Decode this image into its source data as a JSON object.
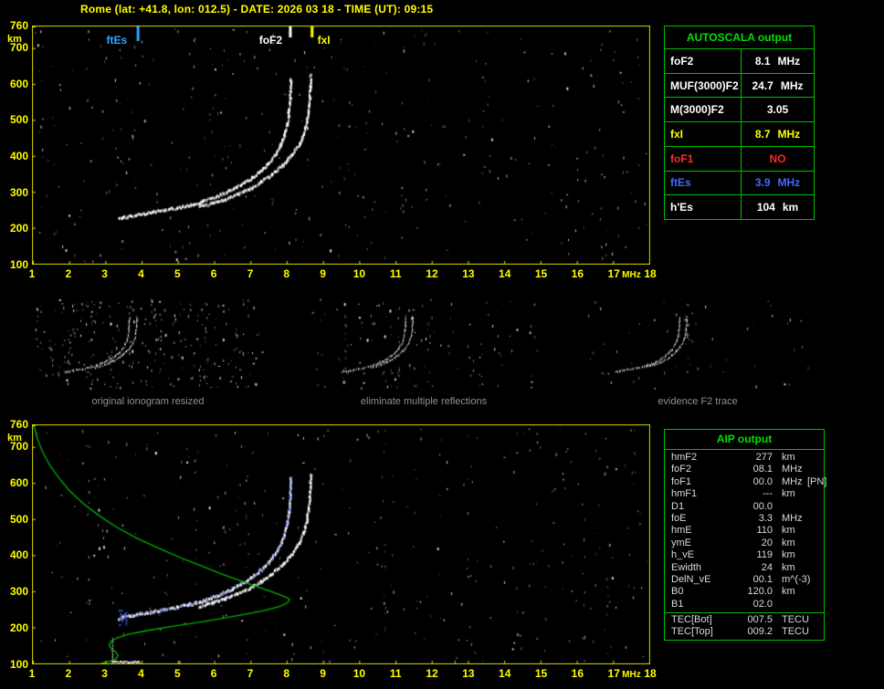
{
  "title": "Rome (lat: +41.8, lon: 012.5) - DATE: 2026 03 18 - TIME (UT): 09:15",
  "colors": {
    "background": "#000000",
    "axis_yellow": "#ffff00",
    "table_green": "#00bf00",
    "header_green": "#00e000",
    "white": "#ffffff",
    "red": "#ff2a2a",
    "blue": "#4169ff",
    "caption_gray": "#8f8f8f"
  },
  "autoscala_table": {
    "header": "AUTOSCALA output",
    "rows": [
      {
        "label": "foF2",
        "value": "8.1",
        "unit": "MHz",
        "color": "#ffffff"
      },
      {
        "label": "MUF(3000)F2",
        "value": "24.7",
        "unit": "MHz",
        "color": "#ffffff"
      },
      {
        "label": "M(3000)F2",
        "value": "3.05",
        "unit": "",
        "color": "#ffffff"
      },
      {
        "label": "fxI",
        "value": "8.7",
        "unit": "MHz",
        "color": "#ffff00"
      },
      {
        "label": "foF1",
        "value": "NO",
        "unit": "",
        "color": "#ff2a2a"
      },
      {
        "label": "ftEs",
        "value": "3.9",
        "unit": "MHz",
        "color": "#4169ff"
      },
      {
        "label": "h'Es",
        "value": "104",
        "unit": "km",
        "color": "#ffffff"
      }
    ]
  },
  "aip_table": {
    "header": "AIP output",
    "rows": [
      {
        "label": "hmF2",
        "value": "277",
        "unit": "km",
        "extra": ""
      },
      {
        "label": "foF2",
        "value": "08.1",
        "unit": "MHz",
        "extra": ""
      },
      {
        "label": "foF1",
        "value": "00.0",
        "unit": "MHz",
        "extra": "[PN]"
      },
      {
        "label": "hmF1",
        "value": "---",
        "unit": "km",
        "extra": ""
      },
      {
        "label": "D1",
        "value": "00.0",
        "unit": "",
        "extra": ""
      },
      {
        "label": "foE",
        "value": "3.3",
        "unit": "MHz",
        "extra": ""
      },
      {
        "label": "hmE",
        "value": "110",
        "unit": "km",
        "extra": ""
      },
      {
        "label": "ymE",
        "value": "20",
        "unit": "km",
        "extra": ""
      },
      {
        "label": "h_vE",
        "value": "119",
        "unit": "km",
        "extra": ""
      },
      {
        "label": "Ewidth",
        "value": "24",
        "unit": "km",
        "extra": ""
      },
      {
        "label": "DelN_vE",
        "value": "00.1",
        "unit": "m^(-3)",
        "extra": ""
      },
      {
        "label": "B0",
        "value": "120.0",
        "unit": "km",
        "extra": ""
      },
      {
        "label": "B1",
        "value": "02.0",
        "unit": "",
        "extra": ""
      }
    ],
    "tec_rows": [
      {
        "label": "TEC[Bot]",
        "value": "007.5",
        "unit": "TECU"
      },
      {
        "label": "TEC[Top]",
        "value": "009.2",
        "unit": "TECU"
      }
    ]
  },
  "thumbnails": [
    {
      "caption": "original ionogram resized"
    },
    {
      "caption": "eliminate multiple reflections"
    },
    {
      "caption": "evidence F2 trace"
    }
  ],
  "chart_data": {
    "type": "scatter",
    "description": "Vertical incidence ionogram: virtual height (km) vs sounding frequency (MHz); top panel measured ionogram, bottom panel restored trace with electron density profile",
    "xlabel": "MHz",
    "ylabel": "km",
    "xlim": [
      1,
      18
    ],
    "ylim": [
      100,
      760
    ],
    "x_ticks": [
      1,
      2,
      3,
      4,
      5,
      6,
      7,
      8,
      9,
      10,
      11,
      12,
      13,
      14,
      15,
      16,
      17,
      18
    ],
    "y_ticks": [
      760,
      700,
      600,
      500,
      400,
      300,
      200,
      100
    ],
    "markers": [
      {
        "label": "ftEs",
        "freq": 3.9,
        "color": "#2fa8ff"
      },
      {
        "label": "foF2",
        "freq": 8.1,
        "color": "#ffffff"
      },
      {
        "label": "fxI",
        "freq": 8.7,
        "color": "#ffff00"
      }
    ],
    "o_trace": [
      [
        3.38,
        224
      ],
      [
        3.52,
        229
      ],
      [
        3.72,
        232
      ],
      [
        4.0,
        237
      ],
      [
        4.3,
        242
      ],
      [
        4.65,
        248
      ],
      [
        5.0,
        255
      ],
      [
        5.35,
        263
      ],
      [
        5.7,
        273
      ],
      [
        6.05,
        286
      ],
      [
        6.4,
        301
      ],
      [
        6.75,
        319
      ],
      [
        7.05,
        338
      ],
      [
        7.35,
        362
      ],
      [
        7.6,
        390
      ],
      [
        7.8,
        420
      ],
      [
        7.93,
        452
      ],
      [
        8.02,
        488
      ],
      [
        8.07,
        522
      ],
      [
        8.1,
        558
      ],
      [
        8.11,
        590
      ],
      [
        8.12,
        615
      ]
    ],
    "x_trace": [
      [
        5.6,
        258
      ],
      [
        5.95,
        267
      ],
      [
        6.3,
        278
      ],
      [
        6.65,
        292
      ],
      [
        7.0,
        308
      ],
      [
        7.3,
        326
      ],
      [
        7.6,
        348
      ],
      [
        7.9,
        374
      ],
      [
        8.15,
        402
      ],
      [
        8.35,
        432
      ],
      [
        8.48,
        462
      ],
      [
        8.56,
        495
      ],
      [
        8.61,
        528
      ],
      [
        8.64,
        560
      ],
      [
        8.66,
        592
      ],
      [
        8.67,
        622
      ]
    ],
    "es_trace": [
      [
        3.18,
        104
      ],
      [
        3.95,
        104
      ]
    ],
    "es_vertical": [
      [
        3.2,
        100
      ],
      [
        3.2,
        168
      ]
    ],
    "profile_green": [
      [
        1.03,
        758
      ],
      [
        1.12,
        724
      ],
      [
        1.26,
        688
      ],
      [
        1.45,
        652
      ],
      [
        1.7,
        616
      ],
      [
        2.0,
        580
      ],
      [
        2.38,
        544
      ],
      [
        2.82,
        510
      ],
      [
        3.3,
        478
      ],
      [
        3.85,
        448
      ],
      [
        4.45,
        420
      ],
      [
        5.05,
        394
      ],
      [
        5.65,
        370
      ],
      [
        6.2,
        348
      ],
      [
        6.75,
        328
      ],
      [
        7.2,
        312
      ],
      [
        7.6,
        298
      ],
      [
        7.9,
        287
      ],
      [
        8.05,
        280
      ],
      [
        8.08,
        277
      ],
      [
        8.02,
        268
      ],
      [
        7.8,
        258
      ],
      [
        7.4,
        247
      ],
      [
        6.85,
        236
      ],
      [
        6.2,
        224
      ],
      [
        5.5,
        213
      ],
      [
        4.8,
        202
      ],
      [
        4.15,
        191
      ],
      [
        3.6,
        180
      ],
      [
        3.3,
        170
      ],
      [
        3.15,
        160
      ],
      [
        3.1,
        150
      ],
      [
        3.18,
        140
      ],
      [
        3.3,
        130
      ],
      [
        3.35,
        122
      ],
      [
        3.3,
        114
      ],
      [
        3.2,
        108
      ],
      [
        3.0,
        103
      ],
      [
        2.88,
        100
      ]
    ],
    "profile_color": "#00bb00",
    "restored_trace_color": "#5470ff"
  }
}
